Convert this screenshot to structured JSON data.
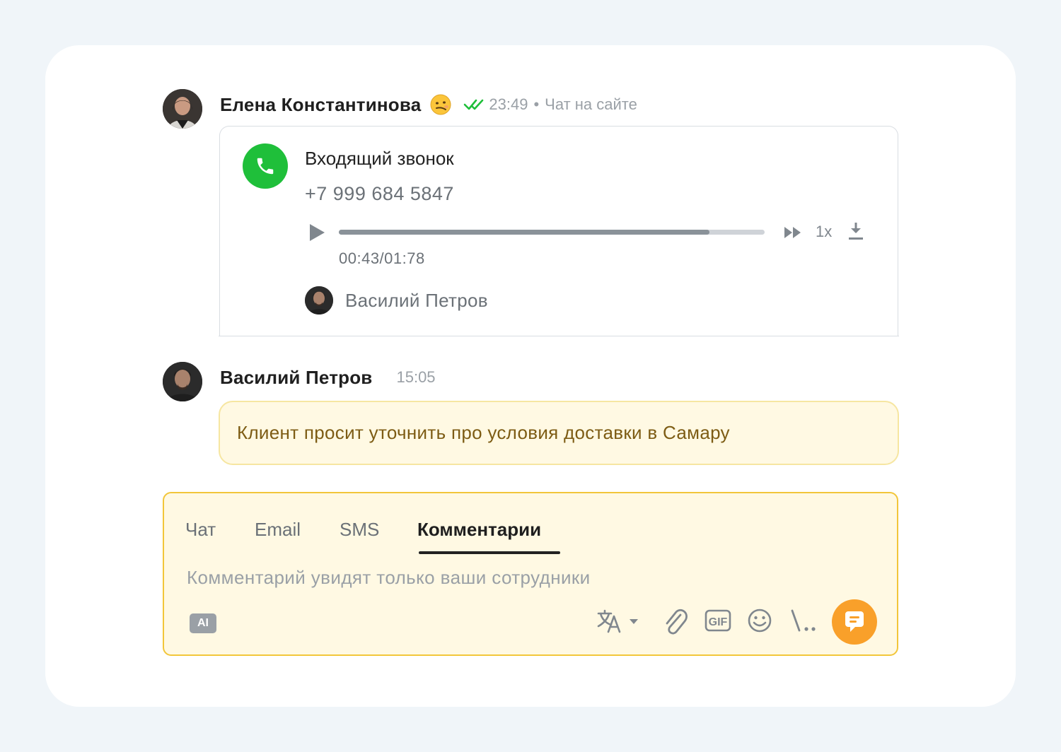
{
  "message1": {
    "author": "Елена Константинова",
    "emoji_icon": "smirking-face-emoji",
    "status_icon": "double-check-icon",
    "time": "23:49",
    "separator": "•",
    "channel": "Чат на сайте"
  },
  "call": {
    "title": "Входящий звонок",
    "phone": "+7 999 684 5847",
    "progress_fraction": 0.87,
    "time": "00:43/01:78",
    "speed": "1x",
    "agent_name": "Василий Петров",
    "colors": {
      "call_icon": "#1fbf3a",
      "progress_fill": "#8a9299",
      "progress_track": "#cfd3d8"
    }
  },
  "message2": {
    "author": "Василий Петров",
    "time": "15:05",
    "text": "Клиент просит уточнить про условия доставки в Самару"
  },
  "composer": {
    "tabs": [
      {
        "label": "Чат",
        "active": false
      },
      {
        "label": "Email",
        "active": false
      },
      {
        "label": "SMS",
        "active": false
      },
      {
        "label": "Комментарии",
        "active": true
      }
    ],
    "placeholder": "Комментарий увидят только ваши сотрудники",
    "ai_label": "AI",
    "tools": [
      "translate-icon",
      "attachment-icon",
      "gif-icon",
      "emoji-icon",
      "quick-reply-icon"
    ],
    "send_icon": "comment-send-icon",
    "colors": {
      "border": "#f2c63a",
      "background": "#fff9e3",
      "send_button": "#f9a02a"
    }
  }
}
